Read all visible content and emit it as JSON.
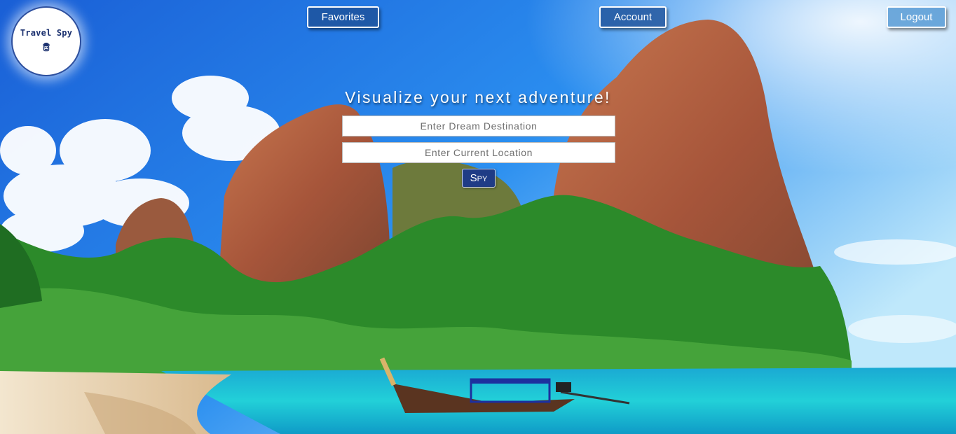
{
  "logo": {
    "text": "Travel Spy",
    "icon": "spy-icon"
  },
  "nav": {
    "favorites_label": "Favorites",
    "account_label": "Account",
    "logout_label": "Logout"
  },
  "hero": {
    "headline": "Visualize your next adventure!",
    "dream_placeholder": "Enter Dream Destination",
    "current_placeholder": "Enter Current Location",
    "dream_value": "",
    "current_value": "",
    "spy_label": "Spy"
  },
  "background": {
    "scene": "tropical-beach-photo"
  },
  "colors": {
    "nav_button_bg": "#1e5096",
    "spy_button_bg": "#1f3c86",
    "logo_border": "#2d4f9e"
  }
}
